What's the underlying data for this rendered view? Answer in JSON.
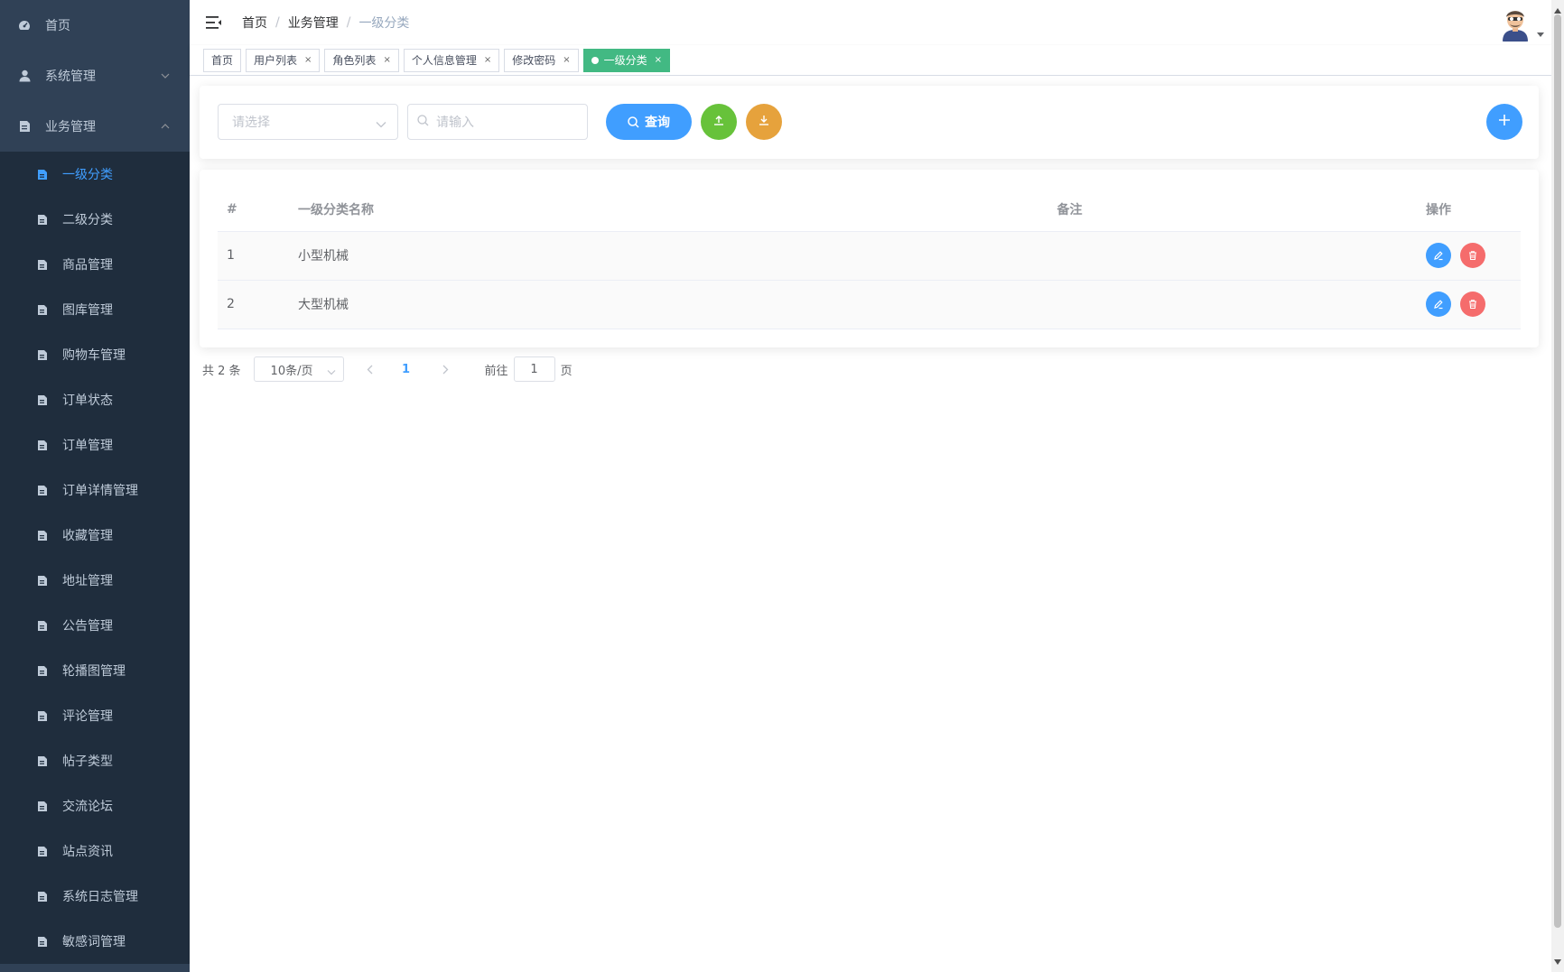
{
  "sidebar": {
    "top_items": [
      {
        "label": "首页",
        "icon": "dashboard-icon"
      },
      {
        "label": "系统管理",
        "icon": "user-icon"
      },
      {
        "label": "业务管理",
        "icon": "document-icon"
      }
    ],
    "sub_items": [
      {
        "label": "一级分类",
        "active": true
      },
      {
        "label": "二级分类"
      },
      {
        "label": "商品管理"
      },
      {
        "label": "图库管理"
      },
      {
        "label": "购物车管理"
      },
      {
        "label": "订单状态"
      },
      {
        "label": "订单管理"
      },
      {
        "label": "订单详情管理"
      },
      {
        "label": "收藏管理"
      },
      {
        "label": "地址管理"
      },
      {
        "label": "公告管理"
      },
      {
        "label": "轮播图管理"
      },
      {
        "label": "评论管理"
      },
      {
        "label": "帖子类型"
      },
      {
        "label": "交流论坛"
      },
      {
        "label": "站点资讯"
      },
      {
        "label": "系统日志管理"
      },
      {
        "label": "敏感词管理"
      }
    ]
  },
  "header": {
    "breadcrumb": [
      "首页",
      "业务管理",
      "一级分类"
    ],
    "separator": "/"
  },
  "tags": [
    {
      "label": "首页",
      "closable": false
    },
    {
      "label": "用户列表",
      "closable": true
    },
    {
      "label": "角色列表",
      "closable": true
    },
    {
      "label": "个人信息管理",
      "closable": true
    },
    {
      "label": "修改密码",
      "closable": true
    },
    {
      "label": "一级分类",
      "closable": true,
      "active": true
    }
  ],
  "tag_close_glyph": "×",
  "search": {
    "select_placeholder": "请选择",
    "input_placeholder": "请输入",
    "query_label": "查询"
  },
  "table": {
    "headers": [
      "#",
      "一级分类名称",
      "备注",
      "操作"
    ],
    "rows": [
      {
        "idx": "1",
        "name": "小型机械",
        "remark": ""
      },
      {
        "idx": "2",
        "name": "大型机械",
        "remark": ""
      }
    ]
  },
  "pagination": {
    "total": "共 2 条",
    "page_size": "10条/页",
    "current_page": "1",
    "goto_label": "前往",
    "goto_value": "1",
    "page_suffix": "页"
  },
  "colors": {
    "sidebar_bg": "#304156",
    "submenu_bg": "#1f2d3d",
    "primary": "#409eff",
    "success": "#67c23a",
    "warning": "#e6a23c",
    "danger": "#f56c6c",
    "tag_active": "#42b983"
  }
}
